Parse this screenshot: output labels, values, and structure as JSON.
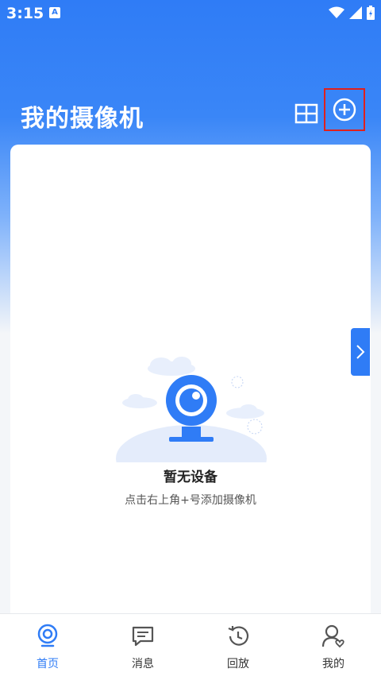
{
  "status_bar": {
    "time": "3:15",
    "notification_letter": "A"
  },
  "header": {
    "title": "我的摄像机"
  },
  "empty_state": {
    "title": "暂无设备",
    "hint": "点击右上角+号添加摄像机"
  },
  "bottom_nav": {
    "items": [
      {
        "label": "首页",
        "icon": "camera-home-icon",
        "active": true
      },
      {
        "label": "消息",
        "icon": "message-icon",
        "active": false
      },
      {
        "label": "回放",
        "icon": "history-icon",
        "active": false
      },
      {
        "label": "我的",
        "icon": "profile-icon",
        "active": false
      }
    ]
  },
  "colors": {
    "accent": "#2f7cf6",
    "highlight_box": "#e0201c"
  }
}
